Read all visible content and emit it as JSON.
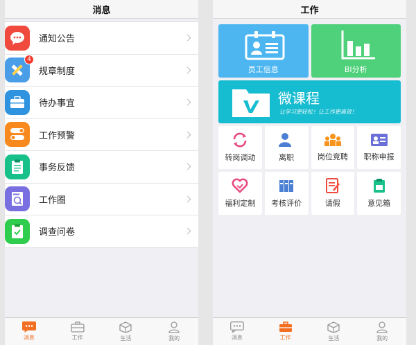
{
  "left": {
    "title": "消息",
    "items": [
      {
        "label": "通知公告",
        "color": "#f0493e",
        "icon": "chat-bubble-icon"
      },
      {
        "label": "规章制度",
        "color": "#4a9ee8",
        "icon": "ruler-pencil-icon",
        "badge": "4"
      },
      {
        "label": "待办事宜",
        "color": "#2f93e0",
        "icon": "briefcase-icon"
      },
      {
        "label": "工作预警",
        "color": "#f7891e",
        "icon": "toggle-icon"
      },
      {
        "label": "事务反馈",
        "color": "#18c08a",
        "icon": "clipboard-icon"
      },
      {
        "label": "工作圈",
        "color": "#7a6fe0",
        "icon": "jobs-circle-icon"
      },
      {
        "label": "调查问卷",
        "color": "#2fcd4e",
        "icon": "checklist-icon"
      }
    ]
  },
  "right": {
    "title": "工作",
    "tiles": [
      {
        "label": "员工信息",
        "color": "#4db6f0"
      },
      {
        "label": "BI分析",
        "color": "#4fd07a"
      }
    ],
    "banner": {
      "title": "微课程",
      "subtitle": "让学习更轻松！让工作更高效！",
      "color": "#16bccf"
    },
    "grid": [
      {
        "label": "转岗调动",
        "icon": "transfer-icon"
      },
      {
        "label": "离职",
        "icon": "resign-icon"
      },
      {
        "label": "岗位竞聘",
        "icon": "compete-icon"
      },
      {
        "label": "职称申报",
        "icon": "title-card-icon"
      },
      {
        "label": "福利定制",
        "icon": "welfare-icon"
      },
      {
        "label": "考核评价",
        "icon": "evaluation-icon"
      },
      {
        "label": "请假",
        "icon": "leave-icon"
      },
      {
        "label": "意见箱",
        "icon": "suggestion-box-icon"
      }
    ]
  },
  "tabbar": {
    "tabs": [
      "消息",
      "工作",
      "生活",
      "我的"
    ],
    "active_color": "#f26f21"
  }
}
